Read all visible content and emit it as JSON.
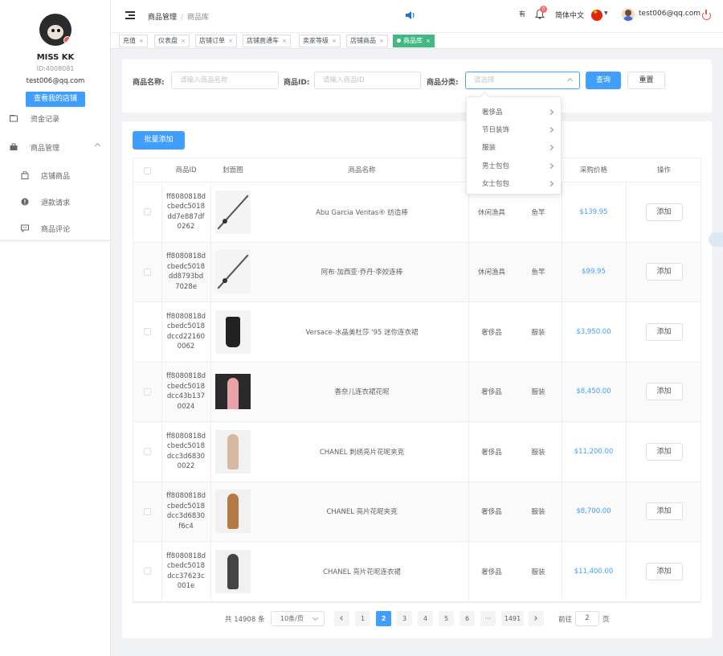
{
  "user": {
    "name": "MISS KK",
    "id": "ID:4008081",
    "email": "test006@qq.com",
    "store_button": "查看我的店铺"
  },
  "sidebar": {
    "items": [
      {
        "label": "资金记录",
        "icon": "wallet-icon"
      },
      {
        "label": "商品管理",
        "icon": "briefcase-icon"
      },
      {
        "label": "店铺商品",
        "icon": "shopping-bag-icon"
      },
      {
        "label": "退款请求",
        "icon": "alert-circle-icon"
      },
      {
        "label": "商品评论",
        "icon": "comment-icon"
      }
    ]
  },
  "header": {
    "breadcrumb": [
      "商品管理",
      "商品库"
    ],
    "language": "简体中文",
    "account": "test006@qq.com",
    "bell_count": "0",
    "mini_label": "有"
  },
  "tabs": [
    "充值",
    "仪表盘",
    "店铺订单",
    "店铺直通车",
    "卖家等级",
    "店铺商品",
    "商品库"
  ],
  "search": {
    "name_label": "商品名称:",
    "name_placeholder": "请输入商品名称",
    "id_label": "商品ID:",
    "id_placeholder": "请输入商品ID",
    "category_label": "商品分类:",
    "category_placeholder": "请选择",
    "query_button": "查询",
    "reset_button": "重置"
  },
  "dropdown": {
    "options": [
      "奢侈品",
      "节日装饰",
      "服装",
      "男士包包",
      "女士包包"
    ]
  },
  "table": {
    "batch_button": "批量添加",
    "columns": [
      "商品ID",
      "封面图",
      "商品名称",
      "",
      "",
      "采购价格",
      "操作"
    ],
    "action_label": "添加",
    "rows": [
      {
        "id": [
          "ff8080818d",
          "cbedc5018",
          "dd7e887df",
          "0262"
        ],
        "name": "Abu Garcia Ventas® 纺造棒",
        "cat1": "休闲渔具",
        "cat2": "鱼竿",
        "price": "$139.95"
      },
      {
        "id": [
          "ff8080818d",
          "cbedc5018",
          "dd8793bd",
          "7028e"
        ],
        "name": "阿布·加西亚·乔丹·李姣连棒",
        "cat1": "休闲渔具",
        "cat2": "鱼竿",
        "price": "$99.95"
      },
      {
        "id": [
          "ff8080818d",
          "cbedc5018",
          "dccd22160",
          "0062"
        ],
        "name": "Versace-水晶美杜莎 '95 迷你连衣裙",
        "cat1": "奢侈品",
        "cat2": "服装",
        "price": "$3,950.00"
      },
      {
        "id": [
          "ff8080818d",
          "cbedc5018",
          "dcc43b137",
          "0024"
        ],
        "name": "香奈儿连衣裙花呢",
        "cat1": "奢侈品",
        "cat2": "服装",
        "price": "$8,450.00"
      },
      {
        "id": [
          "ff8080818d",
          "cbedc5018",
          "dcc3d6830",
          "0022"
        ],
        "name": "CHANEL 刺绣亮片花呢夹克",
        "cat1": "奢侈品",
        "cat2": "服装",
        "price": "$11,200.00"
      },
      {
        "id": [
          "ff8080818d",
          "cbedc5018",
          "dcc3d6830",
          "f6c4"
        ],
        "name": "CHANEL 亮片花呢夹克",
        "cat1": "奢侈品",
        "cat2": "服装",
        "price": "$8,700.00"
      },
      {
        "id": [
          "ff8080818d",
          "cbedc5018",
          "dcc37623c",
          "001e"
        ],
        "name": "CHANEL 亮片花呢连衣裙",
        "cat1": "奢侈品",
        "cat2": "服装",
        "price": "$11,400.00"
      }
    ]
  },
  "pagination": {
    "total": "共 14908 条",
    "page_size": "10条/页",
    "pages": [
      "1",
      "2",
      "3",
      "4",
      "5",
      "6",
      "···",
      "1491"
    ],
    "goto_label": "前往",
    "goto_value": "2",
    "page_unit": "页"
  },
  "colors": {
    "primary": "#409eff",
    "active_tab": "#42b983",
    "danger": "#f56c6c"
  }
}
